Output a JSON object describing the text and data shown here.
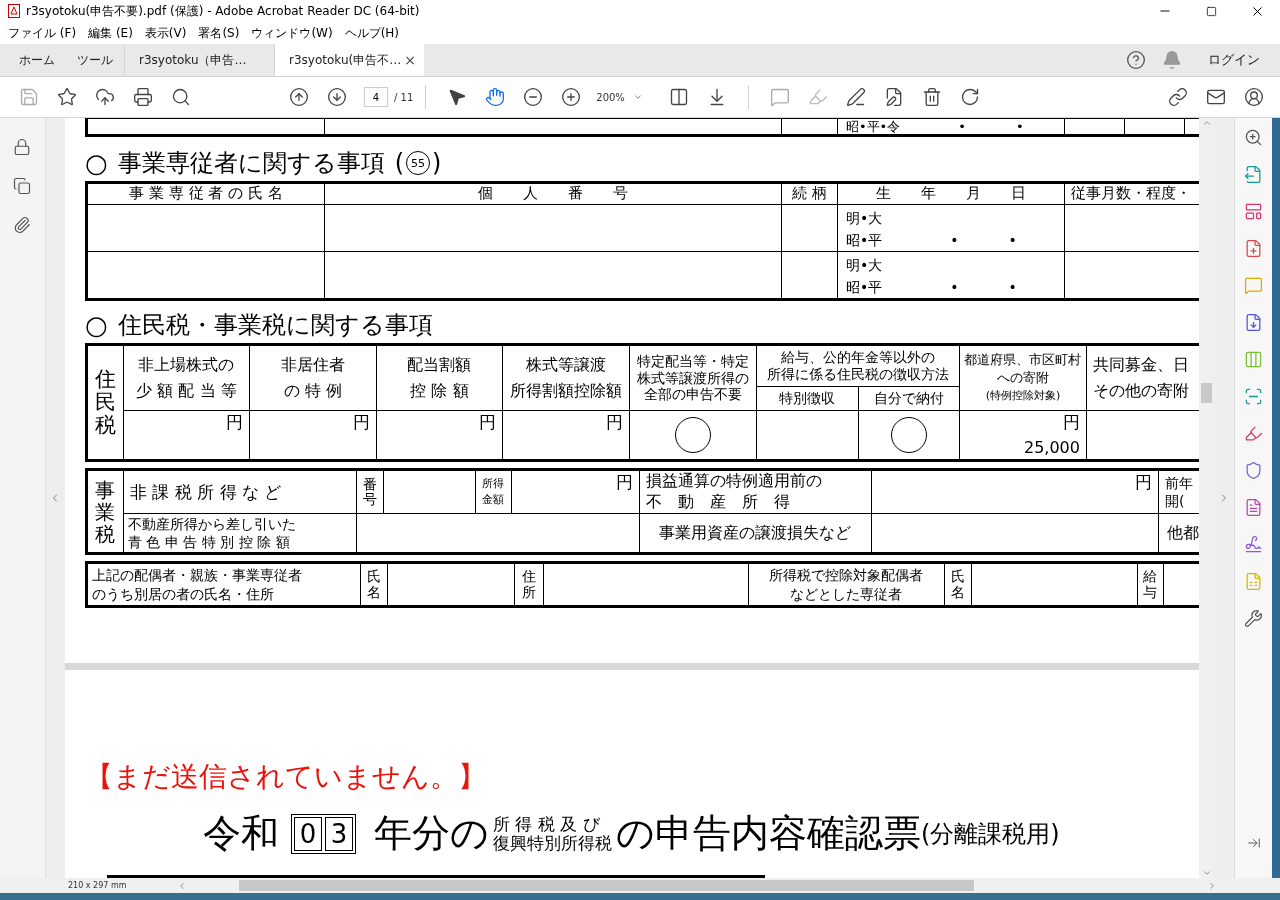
{
  "window": {
    "title": "r3syotoku(申告不要).pdf (保護) - Adobe Acrobat Reader DC (64-bit)"
  },
  "menu": [
    "ファイル (F)",
    "編集 (E)",
    "表示(V)",
    "署名(S)",
    "ウィンドウ(W)",
    "ヘルプ(H)"
  ],
  "tabs": [
    {
      "label": "ホーム",
      "kind": "nav",
      "selected": false
    },
    {
      "label": "ツール",
      "kind": "nav",
      "selected": false
    },
    {
      "label": "r3syotoku（申告…",
      "kind": "doc",
      "selected": false
    },
    {
      "label": "r3syotoku(申告不…",
      "kind": "doc",
      "selected": true,
      "close": "×"
    }
  ],
  "account": {
    "login": "ログイン"
  },
  "toolbar": {
    "page": "4",
    "page_total": "/ 11",
    "zoom": "200%"
  },
  "page": {
    "prev_row": {
      "era": "昭•平•令",
      "dots": [
        "•",
        "•"
      ]
    },
    "section_1": {
      "bullet": "○",
      "heading": "事業専従者に関する事項",
      "ref_open": "(",
      "ref": "55",
      "ref_close": ")"
    },
    "employees_table": {
      "columns": [
        "事 業 専 従 者 の 氏 名",
        "個　　人　　番　　号",
        "続 柄",
        "生　　年　　月　　日",
        "従事月数・程度・"
      ],
      "rows": [
        {
          "era": [
            "明•大",
            "昭•平"
          ],
          "dots": [
            "•",
            "•"
          ]
        },
        {
          "era": [
            "明•大",
            "昭•平"
          ],
          "dots": [
            "•",
            "•"
          ]
        }
      ]
    },
    "section_2": {
      "bullet": "○",
      "heading": "住民税・事業税に関する事項"
    },
    "resident_tax_table": {
      "label": "住民税",
      "columns": [
        {
          "lines": [
            "非上場株式の",
            "少 額 配 当 等"
          ]
        },
        {
          "lines": [
            "非居住者",
            "の 特 例"
          ]
        },
        {
          "lines": [
            "配当割額",
            "控 除 額"
          ]
        },
        {
          "lines": [
            "株式等譲渡",
            "所得割額控除額"
          ]
        },
        {
          "lines": [
            "特定配当等・特定",
            "株式等譲渡所得の",
            "全部の申告不要"
          ]
        },
        {
          "lines": [
            "給与、公的年金等以外の",
            "所得に係る住民税の徴収方法"
          ],
          "children": [
            "特別徴収",
            "自分で納付"
          ]
        },
        {
          "lines": [
            "都道府県、市区町村",
            "への寄附"
          ],
          "note": "(特例控除対象)"
        },
        {
          "lines": [
            "共同募金、日",
            "その他の寄附"
          ]
        }
      ],
      "values": [
        {
          "kind": "yen",
          "unit": "円"
        },
        {
          "kind": "yen",
          "unit": "円"
        },
        {
          "kind": "yen",
          "unit": "円"
        },
        {
          "kind": "yen",
          "unit": "円"
        },
        {
          "kind": "circle"
        },
        {
          "kind": "blank"
        },
        {
          "kind": "circle"
        },
        {
          "kind": "yen",
          "unit": "円",
          "amount": "25,000"
        },
        {
          "kind": "blank"
        }
      ]
    },
    "business_tax_table": {
      "label": "事業税",
      "nontaxable": "非 課 税 所 得 な ど",
      "number_label": "番号",
      "income_label": [
        "所得",
        "金額"
      ],
      "unit": "円",
      "real_estate": [
        "損益通算の特例適用前の",
        "不　動　産　所　得"
      ],
      "real_estate_unit": "円",
      "cut_1": [
        "前年",
        "開("
      ],
      "deduction": [
        "不動産所得から差し引いた",
        "青 色 申 告 特 別 控 除 額"
      ],
      "asset_loss": "事業用資産の譲渡損失など",
      "cut_2": "他都"
    },
    "separated_table": {
      "heading": [
        "上記の配偶者・親族・事業専従者",
        "のうち別居の者の氏名・住所"
      ],
      "name_label": "氏名",
      "address_label": "住所",
      "spouse_heading": [
        "所得税で控除対象配偶者",
        "などとした専従者"
      ],
      "name_label_2": "氏名",
      "salary_label": "給与"
    }
  },
  "next_page": {
    "notice": "【まだ送信されていません。】",
    "era": "令和",
    "year_digits": [
      "0",
      "3"
    ],
    "title_mid": "年分の",
    "tax_names": [
      "所 得 税 及 び",
      "復興特別所得税"
    ],
    "title_main": "の申告内容確認票",
    "title_note": "(分離課税用)"
  },
  "status_bar": {
    "page_size": "210 x 297 mm"
  }
}
